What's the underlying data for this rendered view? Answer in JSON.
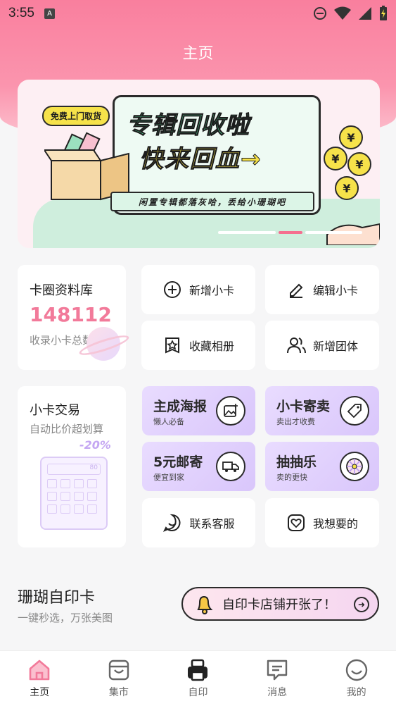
{
  "status": {
    "time": "3:55",
    "notif_badge": "A"
  },
  "header": {
    "title": "主页"
  },
  "banner": {
    "badge": "免费上门取货",
    "line1": "专辑回收啦",
    "line2": "快来回血→",
    "sub": "闲置专辑都落灰哈，丢给小珊瑚吧",
    "coin_symbol": "¥",
    "active_slide": 2,
    "slide_count": 3
  },
  "library": {
    "title": "卡圈资料库",
    "count": "148112",
    "subtitle": "收录小卡总数"
  },
  "quick": {
    "add_card": "新增小卡",
    "edit_card": "编辑小卡",
    "fav_album": "收藏相册",
    "add_group": "新增团体"
  },
  "trade": {
    "title": "小卡交易",
    "subtitle": "自动比价超划算",
    "discount": "-20%",
    "calc_display": "80"
  },
  "features": [
    {
      "title": "主成海报",
      "sub": "懒人必备"
    },
    {
      "title": "小卡寄卖",
      "sub": "卖出才收费"
    },
    {
      "title": "5元邮寄",
      "sub": "便宜到家"
    },
    {
      "title": "抽抽乐",
      "sub": "卖的更快"
    }
  ],
  "service": {
    "contact": "联系客服",
    "wish": "我想要的"
  },
  "print": {
    "title": "珊瑚自印卡",
    "subtitle": "一键秒选，万张美图",
    "pill": "自印卡店铺开张了！"
  },
  "tabs": [
    "主页",
    "集市",
    "自印",
    "消息",
    "我的"
  ],
  "colors": {
    "accent": "#f27a9a",
    "purple": "#d9c6fb"
  }
}
